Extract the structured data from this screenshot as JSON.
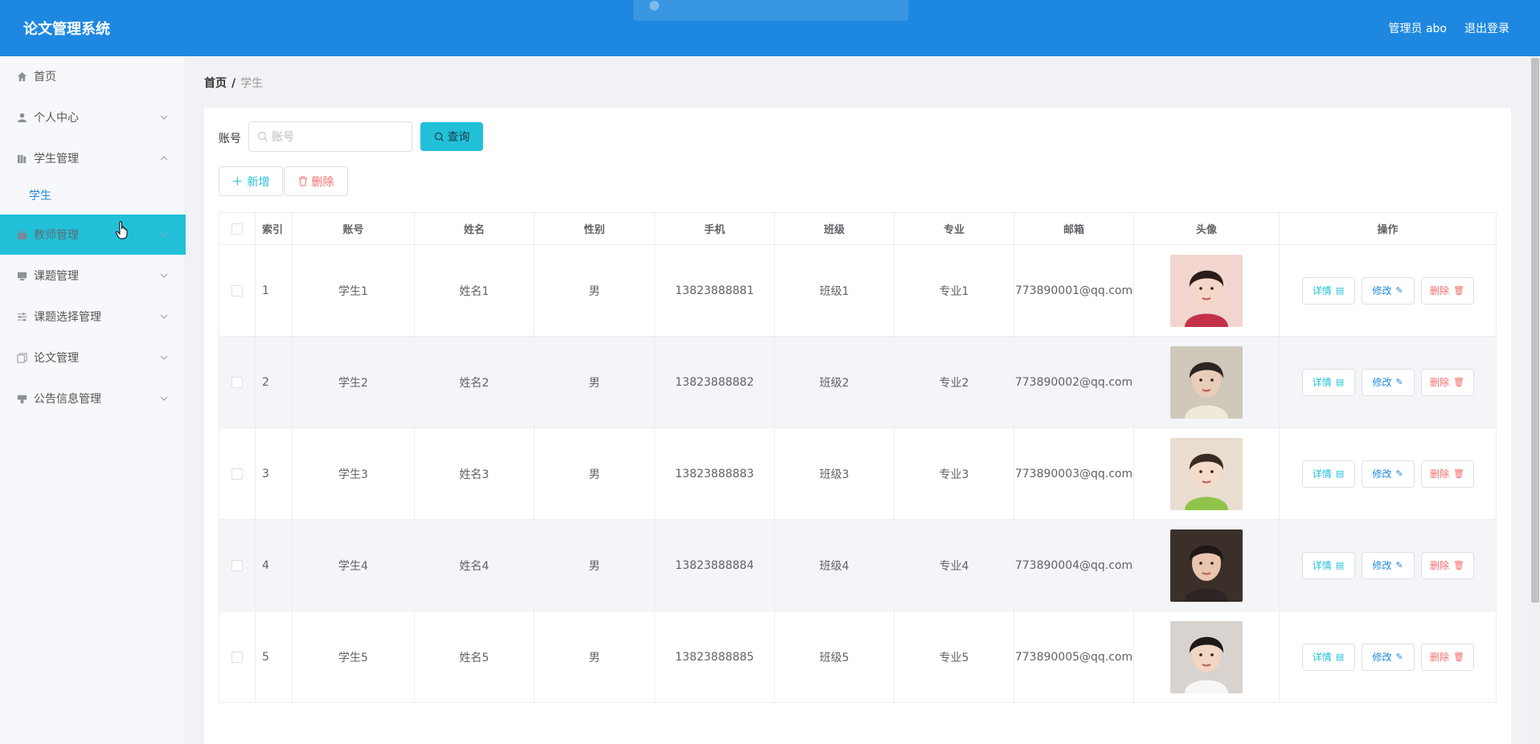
{
  "app": {
    "title": "论文管理系统"
  },
  "header": {
    "user": "管理员 abo",
    "logout": "退出登录"
  },
  "sidebar": {
    "items": [
      {
        "label": "首页",
        "icon": "home-icon"
      },
      {
        "label": "个人中心",
        "icon": "user-icon"
      },
      {
        "label": "学生管理",
        "icon": "library-icon"
      },
      {
        "label": "教师管理",
        "icon": "bag-icon"
      },
      {
        "label": "课题管理",
        "icon": "monitor-icon"
      },
      {
        "label": "课题选择管理",
        "icon": "sliders-icon"
      },
      {
        "label": "论文管理",
        "icon": "copy-icon"
      },
      {
        "label": "公告信息管理",
        "icon": "stamp-icon"
      }
    ],
    "sub": {
      "label": "学生"
    }
  },
  "breadcrumb": {
    "home": "首页",
    "sep": "/",
    "current": "学生"
  },
  "search": {
    "label": "账号",
    "placeholder": "账号",
    "button": "查询"
  },
  "actions": {
    "add": "新增",
    "delete": "删除"
  },
  "table": {
    "headers": [
      "索引",
      "账号",
      "姓名",
      "性别",
      "手机",
      "班级",
      "专业",
      "邮箱",
      "头像",
      "操作"
    ],
    "rows": [
      {
        "idx": "1",
        "account": "学生1",
        "name": "姓名1",
        "sex": "男",
        "phone": "13823888881",
        "cls": "班级1",
        "major": "专业1",
        "email": "773890001@qq.com"
      },
      {
        "idx": "2",
        "account": "学生2",
        "name": "姓名2",
        "sex": "男",
        "phone": "13823888882",
        "cls": "班级2",
        "major": "专业2",
        "email": "773890002@qq.com"
      },
      {
        "idx": "3",
        "account": "学生3",
        "name": "姓名3",
        "sex": "男",
        "phone": "13823888883",
        "cls": "班级3",
        "major": "专业3",
        "email": "773890003@qq.com"
      },
      {
        "idx": "4",
        "account": "学生4",
        "name": "姓名4",
        "sex": "男",
        "phone": "13823888884",
        "cls": "班级4",
        "major": "专业4",
        "email": "773890004@qq.com"
      },
      {
        "idx": "5",
        "account": "学生5",
        "name": "姓名5",
        "sex": "男",
        "phone": "13823888885",
        "cls": "班级5",
        "major": "专业5",
        "email": "773890005@qq.com"
      }
    ],
    "ops": {
      "detail": "详情",
      "edit": "修改",
      "delete": "删除"
    }
  },
  "colors": {
    "primary": "#1e88e0",
    "accent": "#22c0d8",
    "danger": "#f56c6c"
  }
}
